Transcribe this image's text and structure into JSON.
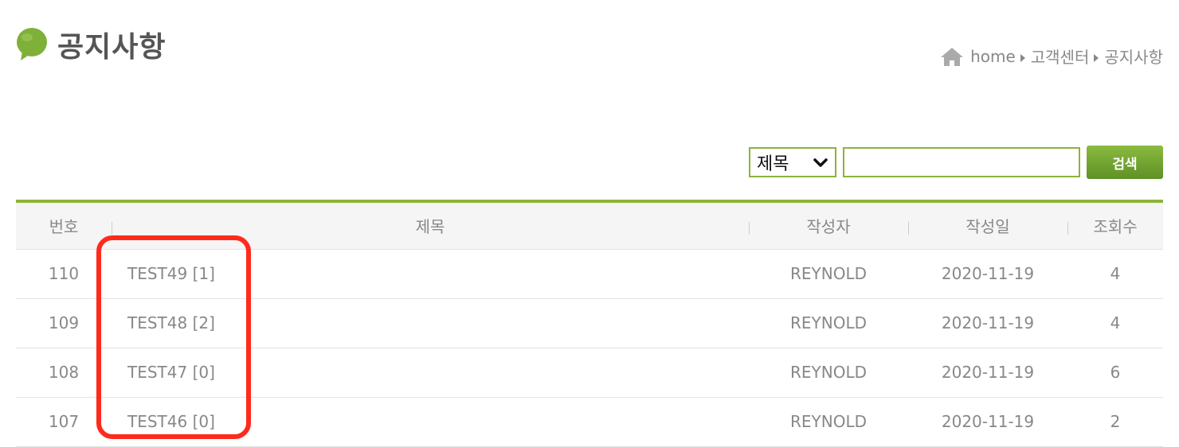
{
  "page": {
    "title": "공지사항"
  },
  "breadcrumb": {
    "home": "home",
    "category": "고객센터",
    "current": "공지사항"
  },
  "search": {
    "field_selected": "제목",
    "input_value": "",
    "button_label": "검색"
  },
  "table": {
    "headers": {
      "number": "번호",
      "title": "제목",
      "author": "작성자",
      "date": "작성일",
      "views": "조회수"
    },
    "rows": [
      {
        "number": "110",
        "title": "TEST49 [1]",
        "author": "REYNOLD",
        "date": "2020-11-19",
        "views": "4"
      },
      {
        "number": "109",
        "title": "TEST48 [2]",
        "author": "REYNOLD",
        "date": "2020-11-19",
        "views": "4"
      },
      {
        "number": "108",
        "title": "TEST47 [0]",
        "author": "REYNOLD",
        "date": "2020-11-19",
        "views": "6"
      },
      {
        "number": "107",
        "title": "TEST46 [0]",
        "author": "REYNOLD",
        "date": "2020-11-19",
        "views": "2"
      }
    ]
  },
  "colors": {
    "accent_green": "#8db33b",
    "highlight_red": "#ff2a1c"
  },
  "icons": {
    "title_icon": "speech-bubble-icon",
    "home_icon": "home-icon",
    "select_icon": "chevron-down-icon"
  }
}
